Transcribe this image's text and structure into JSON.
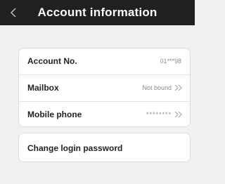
{
  "header": {
    "title": "Account information",
    "back_icon": "chevron-left-icon"
  },
  "account_card": {
    "rows": [
      {
        "label": "Account No.",
        "value": "01***98"
      },
      {
        "label": "Mailbox",
        "value": "Not bound",
        "arrow_icon": "double-chevron-right-icon"
      },
      {
        "label": "Mobile phone",
        "value": "********",
        "arrow_icon": "double-chevron-right-icon"
      }
    ]
  },
  "password_card": {
    "label": "Change login password"
  },
  "colors": {
    "header_bg": "#202020",
    "page_bg": "#f1f1f1",
    "card_bg": "#ffffff"
  }
}
